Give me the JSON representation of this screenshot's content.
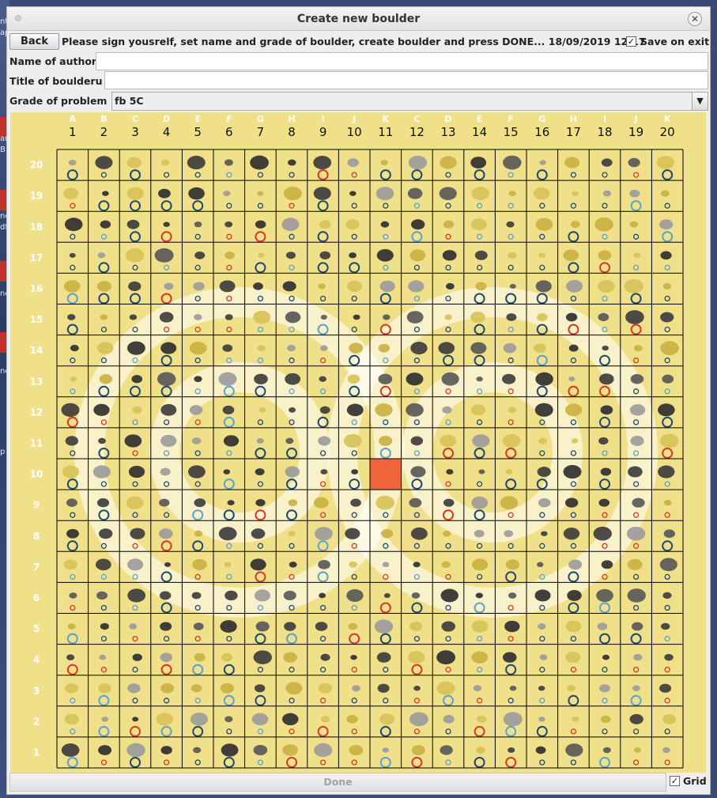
{
  "window": {
    "title": "Create new boulder",
    "close_icon": "close-icon"
  },
  "toolbar": {
    "back_label": "Back",
    "instructions": "Please sign yousrelf, set name and grade of boulder, create boulder and press DONE... 18/09/2019 12:17",
    "save_on_exit_label": "Save on exit",
    "save_on_exit_checked": true
  },
  "form": {
    "author_label": "Name of author",
    "author_value": "",
    "title_label": "Title of boulderu",
    "title_value": "",
    "grade_label": "Grade of problem",
    "grade_value": "fb 5C"
  },
  "board": {
    "column_numbers": [
      "1",
      "2",
      "3",
      "4",
      "5",
      "6",
      "7",
      "8",
      "9",
      "10",
      "11",
      "12",
      "13",
      "14",
      "15",
      "16",
      "17",
      "18",
      "19",
      "20"
    ],
    "column_letters": [
      "A",
      "B",
      "C",
      "D",
      "E",
      "F",
      "G",
      "H",
      "I",
      "J",
      "K",
      "C",
      "D",
      "E",
      "F",
      "G",
      "H",
      "I",
      "J",
      "K"
    ],
    "row_numbers": [
      "20",
      "19",
      "18",
      "17",
      "16",
      "15",
      "14",
      "13",
      "12",
      "11",
      "10",
      "9",
      "8",
      "7",
      "6",
      "5",
      "4",
      "3",
      "2",
      "1"
    ],
    "selected_hold": {
      "column": "11",
      "row": "10"
    },
    "selected_color": "#f0643c",
    "background_color": "#f0e08a",
    "grid_color": "#000000"
  },
  "footer": {
    "done_label": "Done",
    "grid_label": "Grid",
    "grid_checked": true
  },
  "desktop": {
    "side_texts": [
      "nt",
      "ap",
      "ar",
      "B",
      "ne",
      "df",
      "ne",
      "ne",
      "p"
    ]
  }
}
